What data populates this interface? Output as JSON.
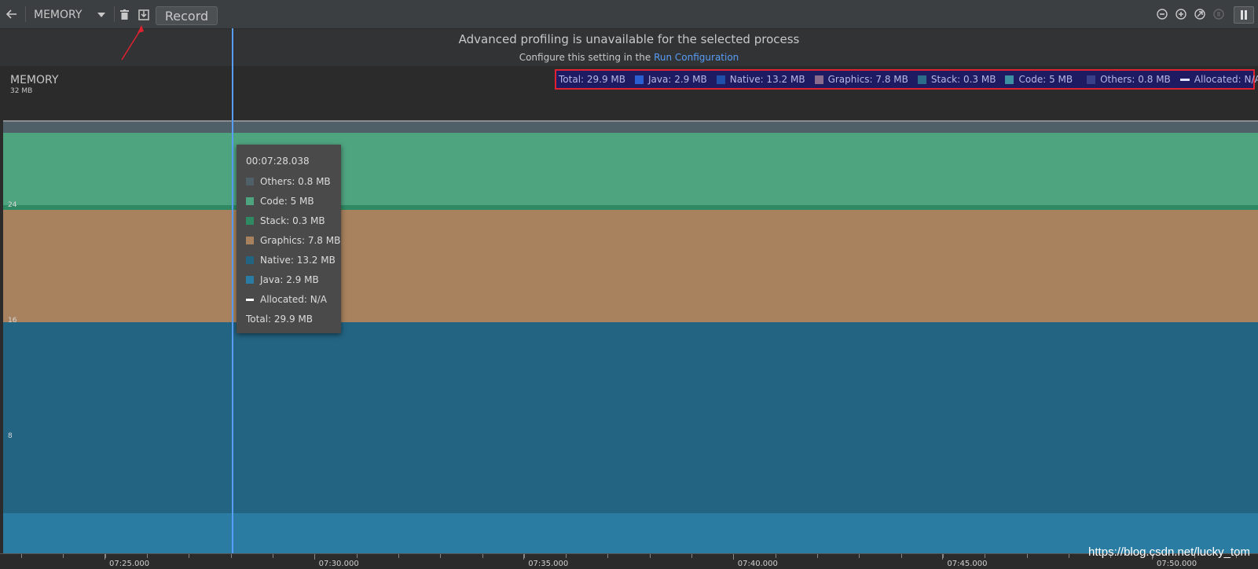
{
  "toolbar": {
    "back_icon": "arrow-left-icon",
    "profiler_select": "MEMORY",
    "delete_icon": "trash-icon",
    "save_icon": "save-heap-icon",
    "record_label": "Record",
    "zoom_out_icon": "zoom-out-icon",
    "zoom_in_icon": "zoom-in-icon",
    "reset_zoom_icon": "reset-zoom-icon",
    "live_icon": "live-icon",
    "pause_icon": "pause-icon"
  },
  "banner": {
    "title": "Advanced profiling is unavailable for the selected process",
    "subtitle_prefix": "Configure this setting in the",
    "link": "Run Configuration"
  },
  "chart_header": {
    "title": "MEMORY",
    "max_label": "32 MB"
  },
  "legend": {
    "total": "Total: 29.9 MB",
    "items": [
      {
        "label": "Java: 2.9 MB",
        "color": "#2b5fd1"
      },
      {
        "label": "Native: 13.2 MB",
        "color": "#1f4fa8"
      },
      {
        "label": "Graphics: 7.8 MB",
        "color": "#8a6b8e"
      },
      {
        "label": "Stack: 0.3 MB",
        "color": "#2a6c8a"
      },
      {
        "label": "Code: 5 MB",
        "color": "#3d8fa2"
      },
      {
        "label": "Others: 0.8 MB",
        "color": "#3a3f8a"
      }
    ],
    "allocated": "Allocated: N/A"
  },
  "chart_data": {
    "type": "area",
    "ylabel": "",
    "y_ticks": [
      "24",
      "16",
      "8"
    ],
    "ylim": [
      0,
      32
    ],
    "x_ticks": [
      "07:25.000",
      "07:30.000",
      "07:35.000",
      "07:40.000",
      "07:45.000",
      "07:50.000"
    ],
    "stacked_series": [
      {
        "name": "Java",
        "value": 2.9,
        "color": "#2a7ca3"
      },
      {
        "name": "Native",
        "value": 13.2,
        "color": "#236483"
      },
      {
        "name": "Graphics",
        "value": 7.8,
        "color": "#a8825e"
      },
      {
        "name": "Stack",
        "value": 0.3,
        "color": "#2f8a63"
      },
      {
        "name": "Code",
        "value": 5,
        "color": "#4fa480"
      },
      {
        "name": "Others",
        "value": 0.8,
        "color": "#4f6068"
      }
    ],
    "total": 29.9
  },
  "tooltip": {
    "time": "00:07:28.038",
    "rows": [
      {
        "label": "Others: 0.8 MB",
        "color": "#4f6068"
      },
      {
        "label": "Code: 5 MB",
        "color": "#4fa480"
      },
      {
        "label": "Stack: 0.3 MB",
        "color": "#2f8a63"
      },
      {
        "label": "Graphics: 7.8 MB",
        "color": "#a8825e"
      },
      {
        "label": "Native: 13.2 MB",
        "color": "#236483"
      },
      {
        "label": "Java: 2.9 MB",
        "color": "#2a7ca3"
      }
    ],
    "allocated": "Allocated: N/A",
    "total": "Total: 29.9 MB"
  },
  "watermark": "https://blog.csdn.net/lucky_tom"
}
